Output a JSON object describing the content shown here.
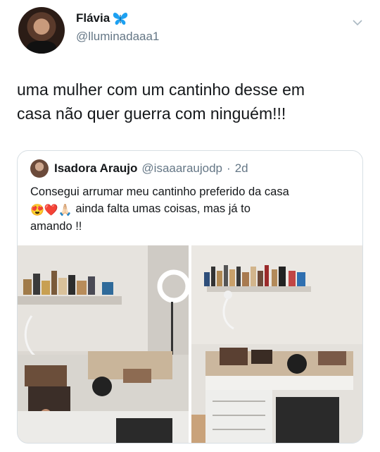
{
  "tweet": {
    "author_name": "Flávia",
    "author_handle": "@lluminadaaa1",
    "badge_icon": "butterfly-icon",
    "text_line1": "uma mulher com um cantinho desse em",
    "text_line2": "casa não quer guerra com ninguém!!!"
  },
  "quoted": {
    "author_name": "Isadora Araujo",
    "author_handle": "@isaaaraujodp",
    "separator": "·",
    "time": "2d",
    "text_line1": "Consegui arrumar meu cantinho preferido da casa",
    "emojis": "😍❤️🙏🏻",
    "text_line2_rest": " ainda falta umas coisas, mas já to",
    "text_line3": "amando !!"
  },
  "colors": {
    "primary_text": "#14171a",
    "secondary_text": "#657786",
    "border": "#d8dfe4",
    "badge_blue": "#1da1f2"
  }
}
